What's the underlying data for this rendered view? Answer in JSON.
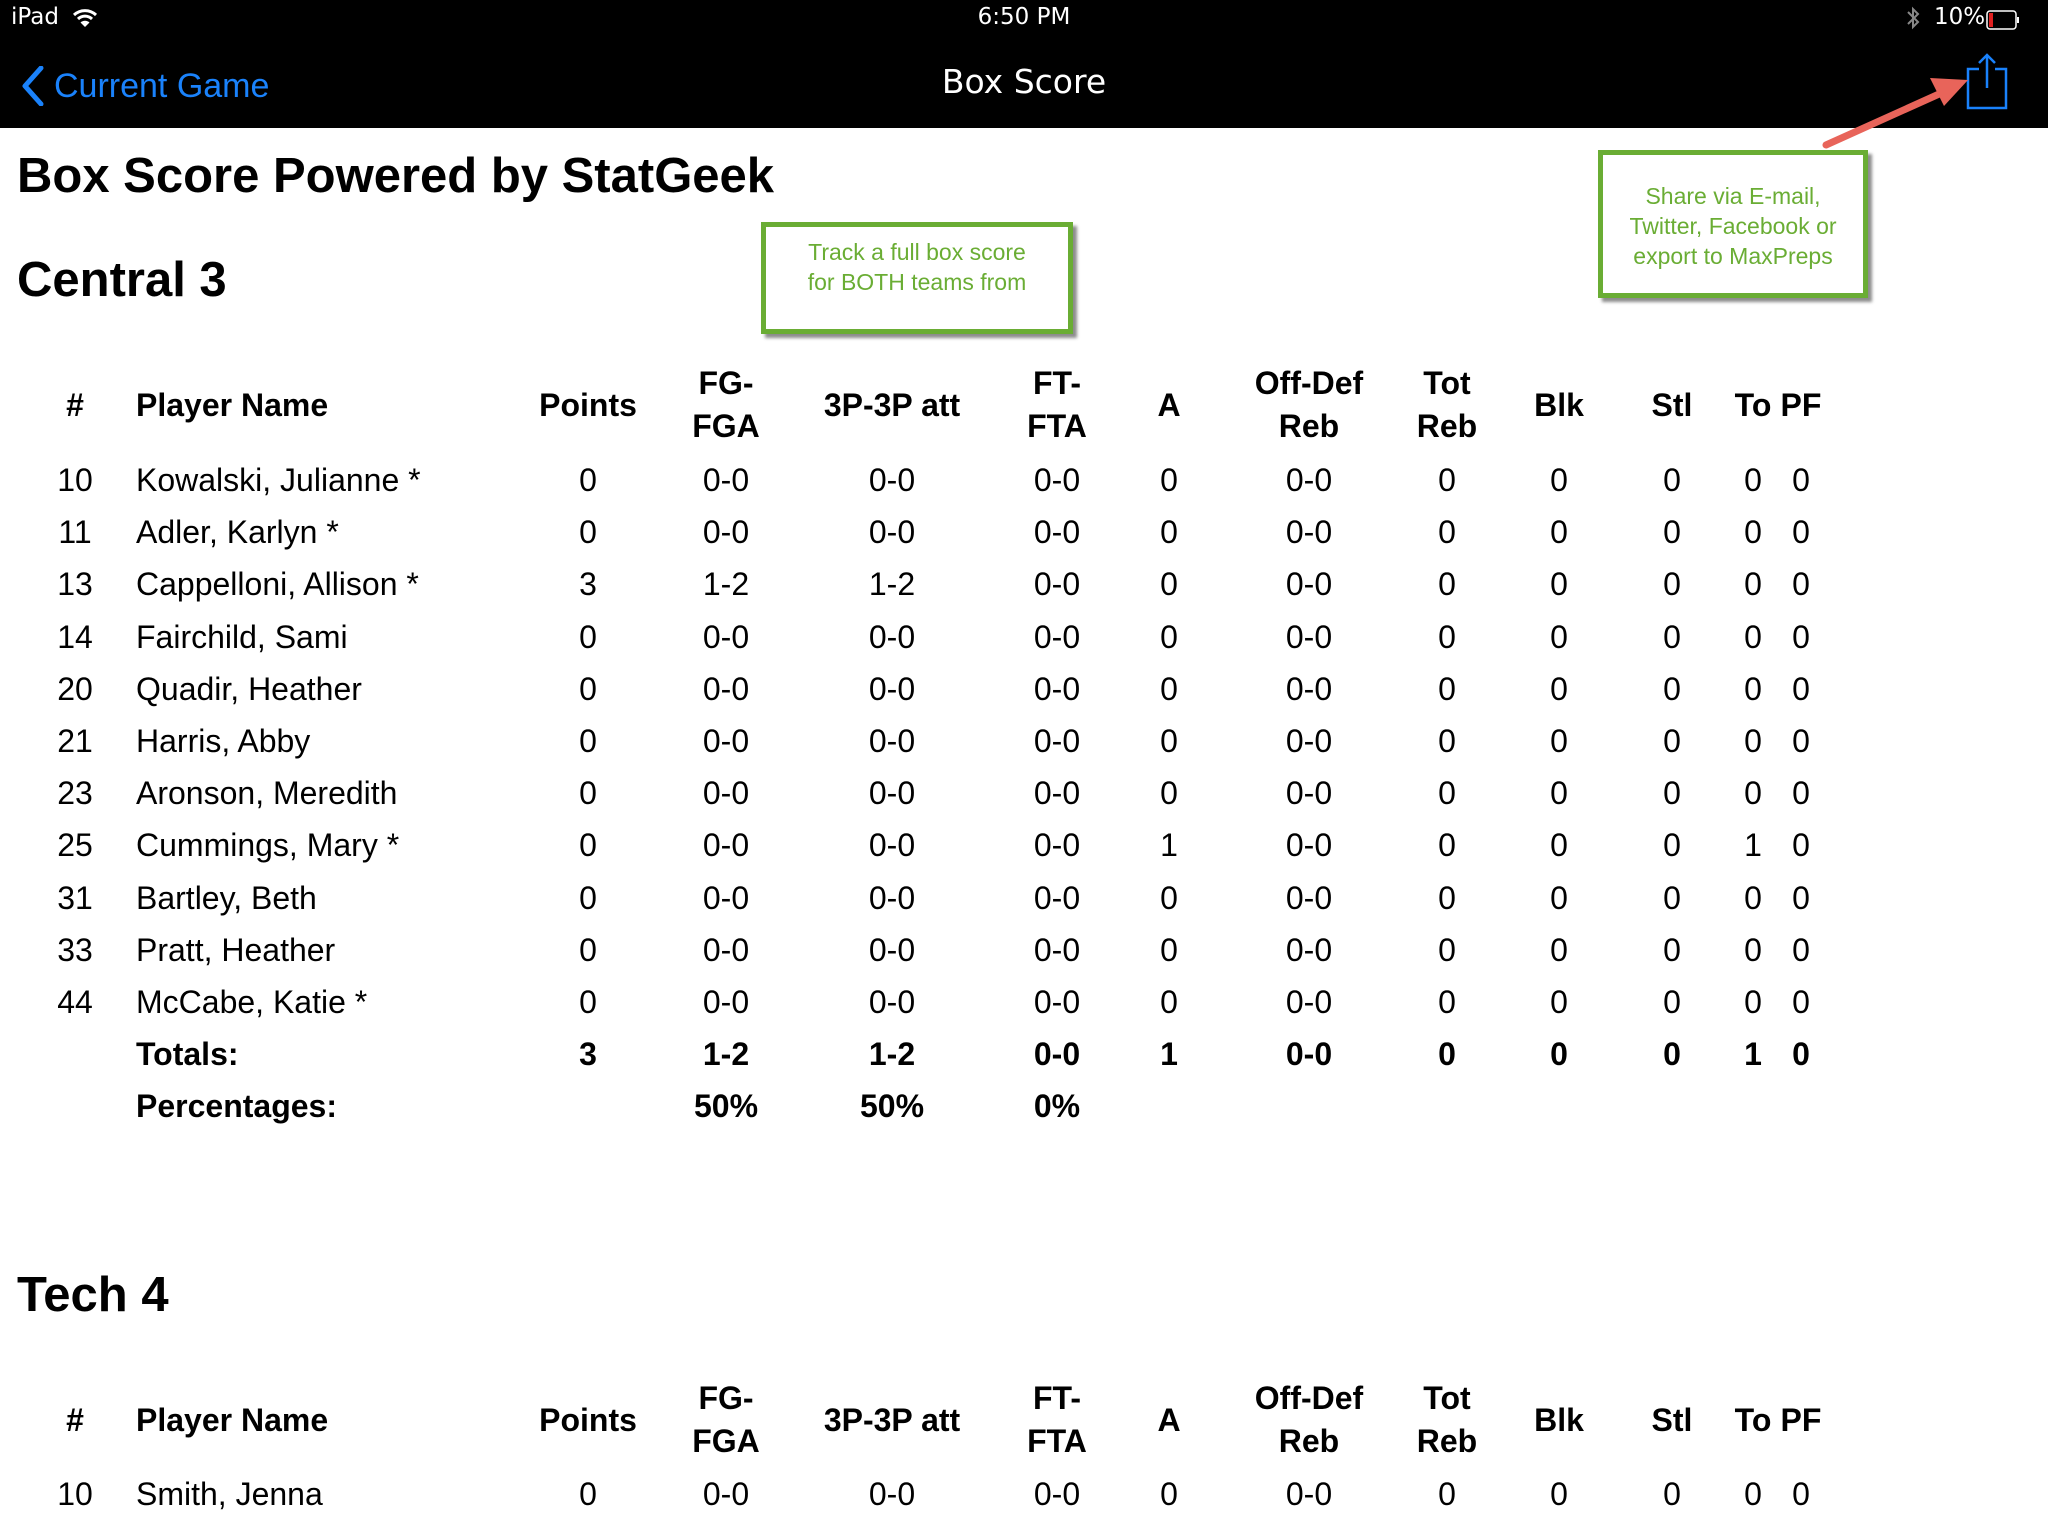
{
  "status_bar": {
    "device": "iPad",
    "time": "6:50 PM",
    "battery": "10%",
    "battery_level": 0.1,
    "wifi_icon": "wifi-icon",
    "bluetooth_icon": "bluetooth-icon"
  },
  "nav": {
    "back_label": "Current Game",
    "title": "Box Score",
    "share_icon": "share-icon"
  },
  "page_title": "Box Score Powered by StatGeek",
  "callouts": {
    "track": [
      "Track a full box score",
      "for BOTH teams from"
    ],
    "share": [
      "Share via E-mail,",
      "Twitter, Facebook or",
      "export to MaxPreps"
    ]
  },
  "columns": [
    {
      "key": "num",
      "label": [
        "#"
      ]
    },
    {
      "key": "name",
      "label": [
        "Player Name"
      ]
    },
    {
      "key": "points",
      "label": [
        "Points"
      ]
    },
    {
      "key": "fg",
      "label": [
        "FG-",
        "FGA"
      ]
    },
    {
      "key": "three",
      "label": [
        "3P-3P att"
      ]
    },
    {
      "key": "ft",
      "label": [
        "FT-",
        "FTA"
      ]
    },
    {
      "key": "a",
      "label": [
        "A"
      ]
    },
    {
      "key": "offdef",
      "label": [
        "Off-Def",
        "Reb"
      ]
    },
    {
      "key": "totreb",
      "label": [
        "Tot",
        "Reb"
      ]
    },
    {
      "key": "blk",
      "label": [
        "Blk"
      ]
    },
    {
      "key": "stl",
      "label": [
        "Stl"
      ]
    },
    {
      "key": "to",
      "label": [
        "To"
      ]
    },
    {
      "key": "pf",
      "label": [
        "PF"
      ]
    }
  ],
  "teams": [
    {
      "title": "Central 3",
      "players": [
        {
          "num": "10",
          "name": "Kowalski, Julianne *",
          "points": "0",
          "fg": "0-0",
          "three": "0-0",
          "ft": "0-0",
          "a": "0",
          "offdef": "0-0",
          "totreb": "0",
          "blk": "0",
          "stl": "0",
          "to": "0",
          "pf": "0"
        },
        {
          "num": "11",
          "name": "Adler, Karlyn *",
          "points": "0",
          "fg": "0-0",
          "three": "0-0",
          "ft": "0-0",
          "a": "0",
          "offdef": "0-0",
          "totreb": "0",
          "blk": "0",
          "stl": "0",
          "to": "0",
          "pf": "0"
        },
        {
          "num": "13",
          "name": "Cappelloni, Allison *",
          "points": "3",
          "fg": "1-2",
          "three": "1-2",
          "ft": "0-0",
          "a": "0",
          "offdef": "0-0",
          "totreb": "0",
          "blk": "0",
          "stl": "0",
          "to": "0",
          "pf": "0"
        },
        {
          "num": "14",
          "name": "Fairchild, Sami",
          "points": "0",
          "fg": "0-0",
          "three": "0-0",
          "ft": "0-0",
          "a": "0",
          "offdef": "0-0",
          "totreb": "0",
          "blk": "0",
          "stl": "0",
          "to": "0",
          "pf": "0"
        },
        {
          "num": "20",
          "name": "Quadir, Heather",
          "points": "0",
          "fg": "0-0",
          "three": "0-0",
          "ft": "0-0",
          "a": "0",
          "offdef": "0-0",
          "totreb": "0",
          "blk": "0",
          "stl": "0",
          "to": "0",
          "pf": "0"
        },
        {
          "num": "21",
          "name": "Harris, Abby",
          "points": "0",
          "fg": "0-0",
          "three": "0-0",
          "ft": "0-0",
          "a": "0",
          "offdef": "0-0",
          "totreb": "0",
          "blk": "0",
          "stl": "0",
          "to": "0",
          "pf": "0"
        },
        {
          "num": "23",
          "name": "Aronson, Meredith",
          "points": "0",
          "fg": "0-0",
          "three": "0-0",
          "ft": "0-0",
          "a": "0",
          "offdef": "0-0",
          "totreb": "0",
          "blk": "0",
          "stl": "0",
          "to": "0",
          "pf": "0"
        },
        {
          "num": "25",
          "name": "Cummings, Mary *",
          "points": "0",
          "fg": "0-0",
          "three": "0-0",
          "ft": "0-0",
          "a": "1",
          "offdef": "0-0",
          "totreb": "0",
          "blk": "0",
          "stl": "0",
          "to": "1",
          "pf": "0"
        },
        {
          "num": "31",
          "name": "Bartley, Beth",
          "points": "0",
          "fg": "0-0",
          "three": "0-0",
          "ft": "0-0",
          "a": "0",
          "offdef": "0-0",
          "totreb": "0",
          "blk": "0",
          "stl": "0",
          "to": "0",
          "pf": "0"
        },
        {
          "num": "33",
          "name": "Pratt, Heather",
          "points": "0",
          "fg": "0-0",
          "three": "0-0",
          "ft": "0-0",
          "a": "0",
          "offdef": "0-0",
          "totreb": "0",
          "blk": "0",
          "stl": "0",
          "to": "0",
          "pf": "0"
        },
        {
          "num": "44",
          "name": "McCabe, Katie *",
          "points": "0",
          "fg": "0-0",
          "three": "0-0",
          "ft": "0-0",
          "a": "0",
          "offdef": "0-0",
          "totreb": "0",
          "blk": "0",
          "stl": "0",
          "to": "0",
          "pf": "0"
        }
      ],
      "totals": {
        "num": "",
        "name": "Totals:",
        "points": "3",
        "fg": "1-2",
        "three": "1-2",
        "ft": "0-0",
        "a": "1",
        "offdef": "0-0",
        "totreb": "0",
        "blk": "0",
        "stl": "0",
        "to": "1",
        "pf": "0"
      },
      "percentages": {
        "num": "",
        "name": "Percentages:",
        "points": "",
        "fg": "50%",
        "three": "50%",
        "ft": "0%",
        "a": "",
        "offdef": "",
        "totreb": "",
        "blk": "",
        "stl": "",
        "to": "",
        "pf": ""
      }
    },
    {
      "title": "Tech 4",
      "players": [
        {
          "num": "10",
          "name": "Smith, Jenna",
          "points": "0",
          "fg": "0-0",
          "three": "0-0",
          "ft": "0-0",
          "a": "0",
          "offdef": "0-0",
          "totreb": "0",
          "blk": "0",
          "stl": "0",
          "to": "0",
          "pf": "0"
        }
      ]
    }
  ],
  "colors": {
    "nav_bg": "#000000",
    "link_blue": "#1a82fb",
    "callout_green": "#6aad34",
    "arrow_red": "#e8645a",
    "battery_red": "#e02020"
  }
}
